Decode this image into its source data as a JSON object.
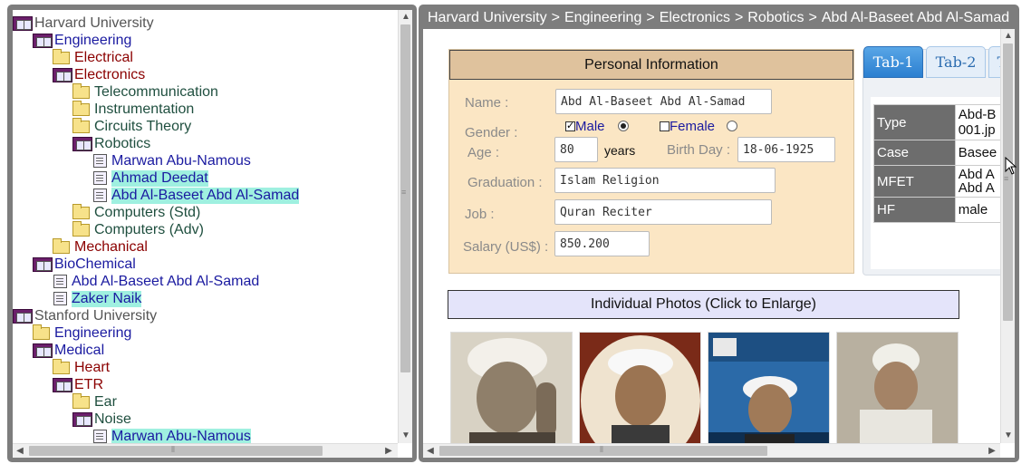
{
  "breadcrumb": [
    "Harvard University",
    "Engineering",
    "Electronics",
    "Robotics",
    "Abd Al-Baseet Abd Al-Samad"
  ],
  "breadcrumb_separator": ">",
  "tree": [
    {
      "label": "Harvard University",
      "icon": "book-icon",
      "color": "gray",
      "hl": false
    },
    {
      "label": "Engineering",
      "icon": "book-icon",
      "color": "blue",
      "hl": false
    },
    {
      "label": "Electrical",
      "icon": "folder-icon",
      "color": "maroon",
      "hl": false
    },
    {
      "label": "Electronics",
      "icon": "book-icon",
      "color": "maroon",
      "hl": false
    },
    {
      "label": "Telecommunication",
      "icon": "folder-icon",
      "color": "green",
      "hl": false
    },
    {
      "label": "Instrumentation",
      "icon": "folder-icon",
      "color": "green",
      "hl": false
    },
    {
      "label": "Circuits Theory",
      "icon": "folder-icon",
      "color": "green",
      "hl": false
    },
    {
      "label": "Robotics",
      "icon": "book-icon",
      "color": "green",
      "hl": false
    },
    {
      "label": "Marwan Abu-Namous",
      "icon": "document-icon",
      "color": "blue",
      "hl": false
    },
    {
      "label": "Ahmad Deedat",
      "icon": "document-icon",
      "color": "blue",
      "hl": true
    },
    {
      "label": "Abd Al-Baseet Abd Al-Samad",
      "icon": "document-icon",
      "color": "blue",
      "hl": true
    },
    {
      "label": "Computers (Std)",
      "icon": "folder-icon",
      "color": "green",
      "hl": false
    },
    {
      "label": "Computers (Adv)",
      "icon": "folder-icon",
      "color": "green",
      "hl": false
    },
    {
      "label": "Mechanical",
      "icon": "folder-icon",
      "color": "maroon",
      "hl": false
    },
    {
      "label": "BioChemical",
      "icon": "book-icon",
      "color": "blue",
      "hl": false
    },
    {
      "label": "Abd Al-Baseet Abd Al-Samad",
      "icon": "document-icon",
      "color": "blue",
      "hl": false
    },
    {
      "label": "Zaker Naik",
      "icon": "document-icon",
      "color": "blue",
      "hl": true
    },
    {
      "label": "Stanford University",
      "icon": "book-icon",
      "color": "gray",
      "hl": false
    },
    {
      "label": "Engineering",
      "icon": "folder-icon",
      "color": "blue",
      "hl": false
    },
    {
      "label": "Medical",
      "icon": "book-icon",
      "color": "blue",
      "hl": false
    },
    {
      "label": "Heart",
      "icon": "folder-icon",
      "color": "maroon",
      "hl": false
    },
    {
      "label": "ETR",
      "icon": "book-icon",
      "color": "maroon",
      "hl": false
    },
    {
      "label": "Ear",
      "icon": "folder-icon",
      "color": "green",
      "hl": false
    },
    {
      "label": "Noise",
      "icon": "book-icon",
      "color": "green",
      "hl": false
    },
    {
      "label": "Marwan Abu-Namous",
      "icon": "document-icon",
      "color": "blue",
      "hl": true
    }
  ],
  "personal": {
    "title": "Personal Information",
    "name_label": "Name :",
    "name_value": "Abd Al-Baseet Abd Al-Samad",
    "gender_label": "Gender :",
    "male_label": "Male",
    "female_label": "Female",
    "male_selected": true,
    "age_label": "Age :",
    "age_value": "80",
    "age_unit": "years",
    "birthday_label": "Birth Day :",
    "birthday_value": "18-06-1925",
    "graduation_label": "Graduation :",
    "graduation_value": "Islam Religion",
    "job_label": "Job :",
    "job_value": "Quran Reciter",
    "salary_label": "Salary (US$) :",
    "salary_value": "850.200"
  },
  "tabs": {
    "items": [
      "Tab-1",
      "Tab-2",
      "T"
    ],
    "active": "Tab-1",
    "rows": [
      {
        "key": "Type",
        "value": "Abd-B 001.jp"
      },
      {
        "key": "Case",
        "value": "Basee"
      },
      {
        "key": "MFET",
        "value": "Abd A Abd A"
      },
      {
        "key": "HF",
        "value": "male"
      }
    ]
  },
  "photos": {
    "header": "Individual Photos (Click to Enlarge)",
    "items": [
      "photo-1",
      "photo-2",
      "photo-3",
      "photo-4"
    ]
  },
  "colors": {
    "frame": "#7d7d7d",
    "panel_bg": "#fbe6c4",
    "panel_title_bg": "#dfc29d",
    "highlight": "#9ff0e0",
    "tab_active": "#3d8fdb"
  }
}
